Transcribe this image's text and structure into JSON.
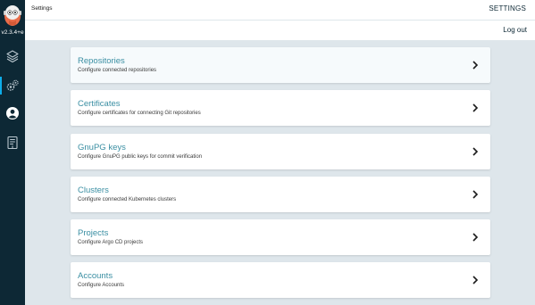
{
  "app": {
    "version": "v2.3.4+e"
  },
  "header": {
    "page_title": "Settings",
    "right_title": "SETTINGS"
  },
  "subheader": {
    "logout_label": "Log out"
  },
  "sidebar": {
    "items": [
      {
        "name": "applications",
        "icon": "layers-icon",
        "active": false
      },
      {
        "name": "settings",
        "icon": "gears-icon",
        "active": true
      },
      {
        "name": "user-info",
        "icon": "user-circle-icon",
        "active": false
      },
      {
        "name": "documentation",
        "icon": "docs-icon",
        "active": false
      }
    ]
  },
  "settings": {
    "cards": [
      {
        "title": "Repositories",
        "description": "Configure connected repositories"
      },
      {
        "title": "Certificates",
        "description": "Configure certificates for connecting Git repositories"
      },
      {
        "title": "GnuPG keys",
        "description": "Configure GnuPG public keys for commit verification"
      },
      {
        "title": "Clusters",
        "description": "Configure connected Kubernetes clusters"
      },
      {
        "title": "Projects",
        "description": "Configure Argo CD projects"
      },
      {
        "title": "Accounts",
        "description": "Configure Accounts"
      }
    ]
  },
  "colors": {
    "sidebar_bg": "#0d2835",
    "accent": "#0dadea",
    "card_title": "#3b8fa3",
    "page_bg": "#dee6eb"
  }
}
